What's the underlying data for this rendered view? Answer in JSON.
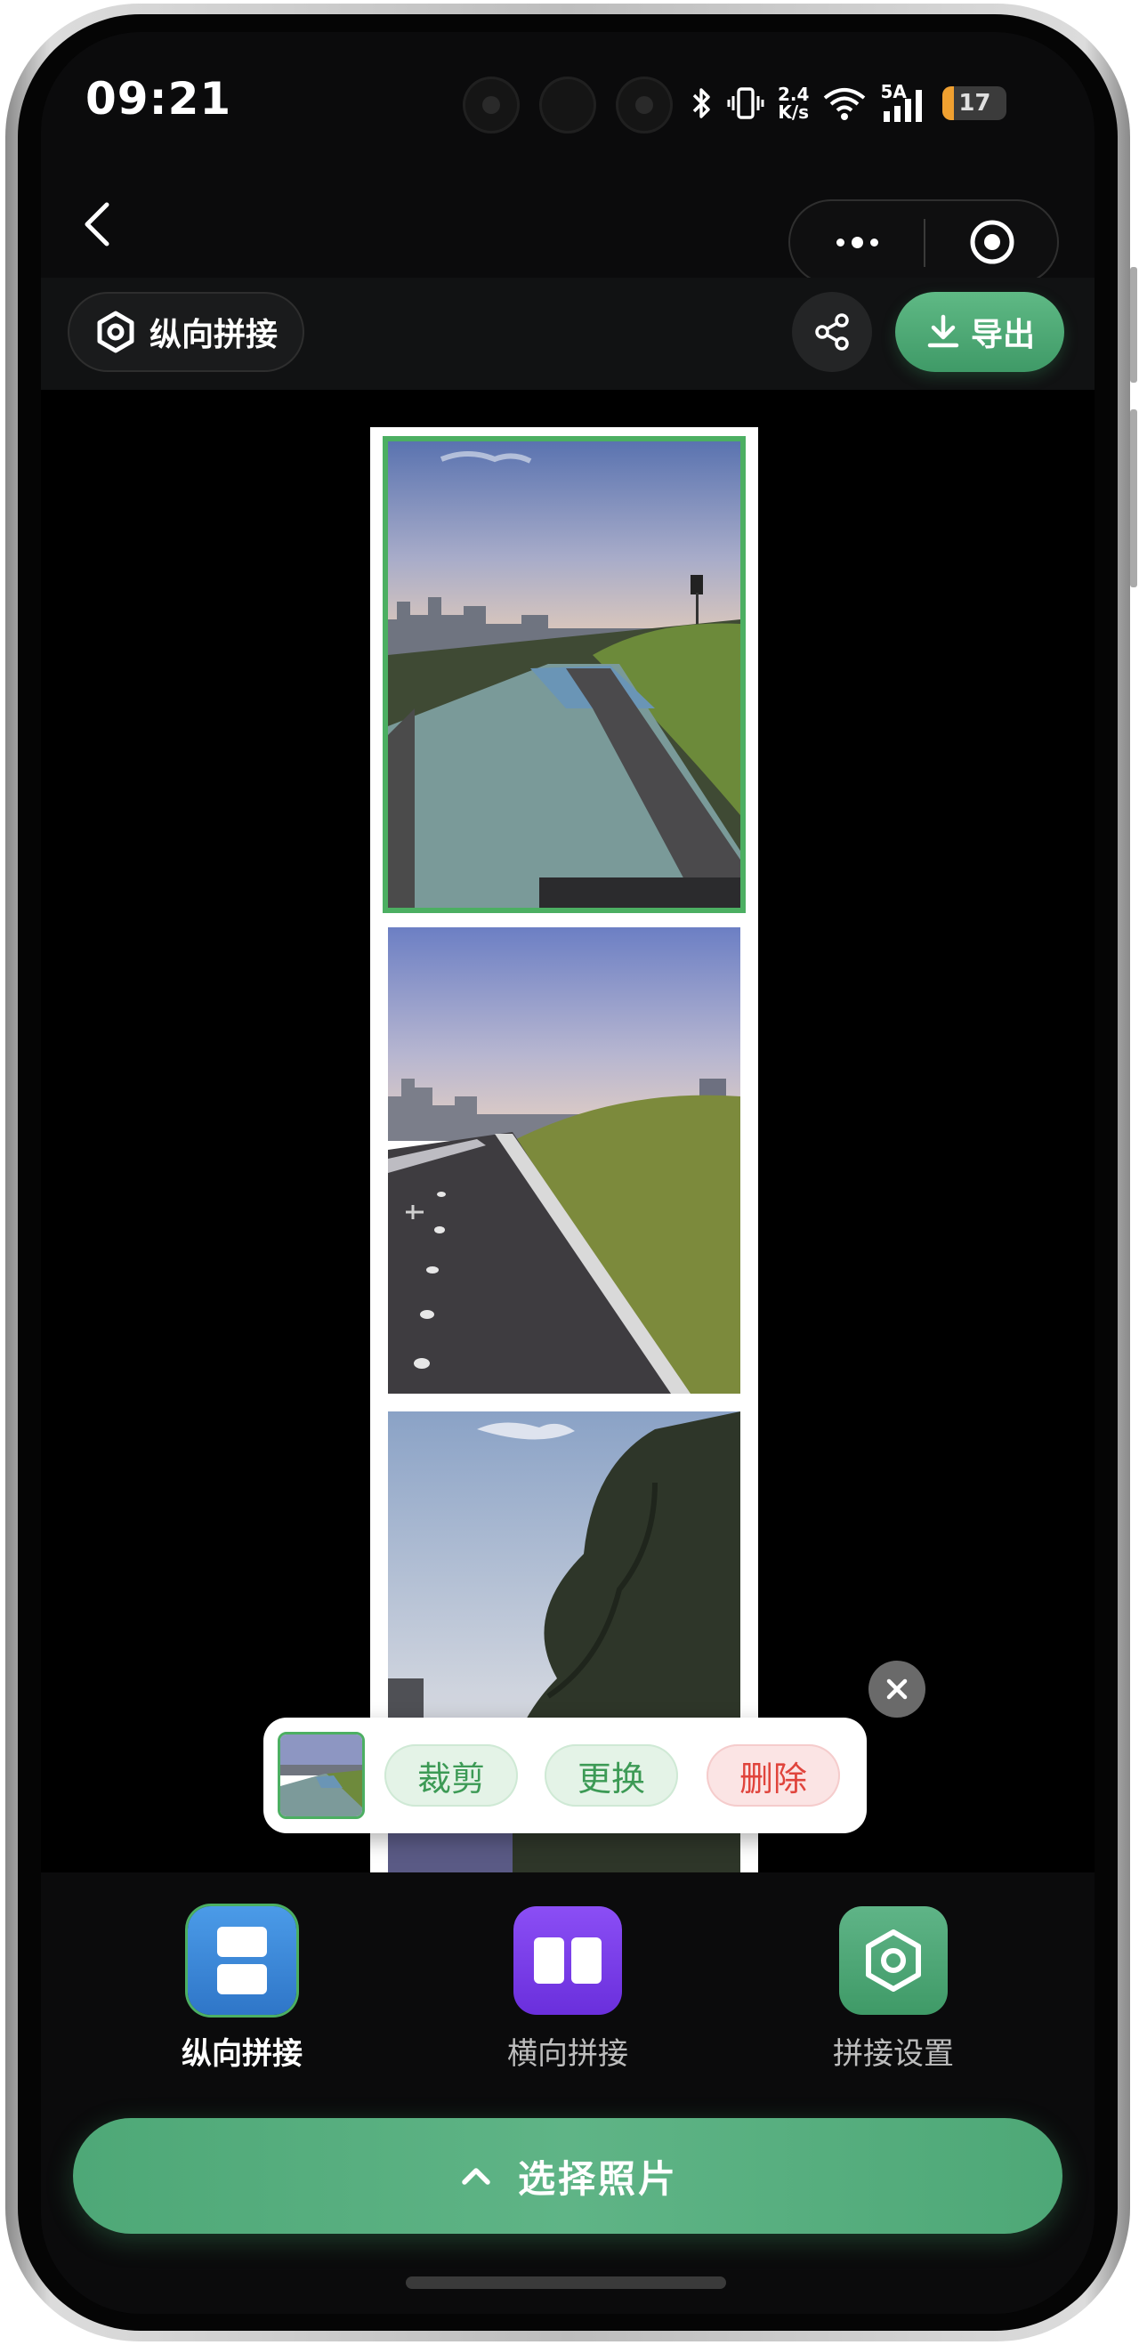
{
  "status_bar": {
    "time": "09:21",
    "network_speed_top": "2.4",
    "network_speed_bottom": "K/s",
    "signal_label": "5A",
    "battery": "17",
    "battery_level": 0.17
  },
  "toolbar": {
    "mode_label": "纵向拼接",
    "export_label": "导出"
  },
  "photos": [
    {
      "name": "photo-1",
      "selected": true
    },
    {
      "name": "photo-2",
      "selected": false
    },
    {
      "name": "photo-3",
      "selected": false
    }
  ],
  "action_panel": {
    "crop_label": "裁剪",
    "replace_label": "更换",
    "delete_label": "删除"
  },
  "modes": [
    {
      "label": "纵向拼接",
      "active": true,
      "icon": "vertical-stitch-icon"
    },
    {
      "label": "横向拼接",
      "active": false,
      "icon": "horizontal-stitch-icon"
    },
    {
      "label": "拼接设置",
      "active": false,
      "icon": "settings-icon"
    }
  ],
  "select_button": {
    "label": "选择照片"
  },
  "colors": {
    "accent_green": "#4caf62",
    "export_green": "#4ea877",
    "delete_red": "#e0443c",
    "horizontal_purple": "#7a3ff0",
    "vertical_blue": "#3a8ee0"
  }
}
